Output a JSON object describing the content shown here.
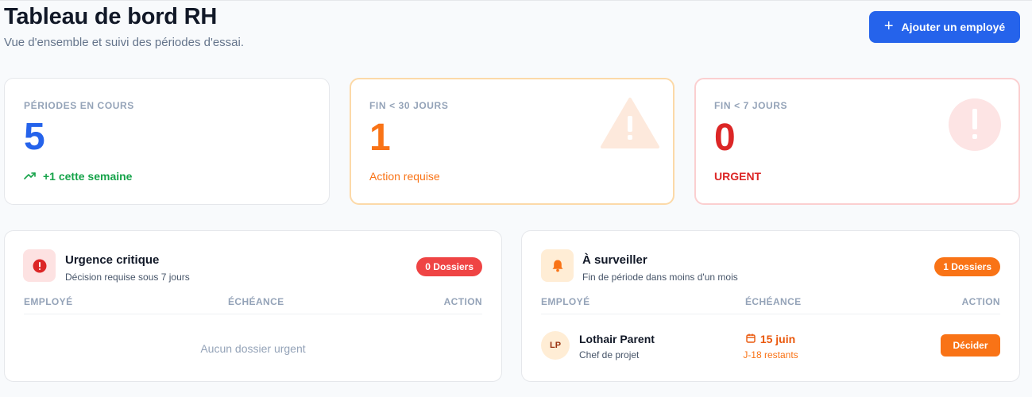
{
  "header": {
    "title": "Tableau de bord RH",
    "subtitle": "Vue d'ensemble et suivi des périodes d'essai.",
    "add_button": "Ajouter un employé"
  },
  "stats": {
    "in_progress": {
      "label": "PÉRIODES EN COURS",
      "value": "5",
      "trend": "+1 cette semaine",
      "icon": "trending-up-icon"
    },
    "ending_30": {
      "label": "FIN < 30 JOURS",
      "value": "1",
      "note": "Action requise",
      "icon": "warning-triangle-icon"
    },
    "ending_7": {
      "label": "FIN < 7 JOURS",
      "value": "0",
      "note": "URGENT",
      "icon": "alert-circle-icon"
    }
  },
  "critical": {
    "title": "Urgence critique",
    "subtitle": "Décision requise sous 7 jours",
    "badge": "0 Dossiers",
    "columns": [
      "EMPLOYÉ",
      "ÉCHÉANCE",
      "ACTION"
    ],
    "empty": "Aucun dossier urgent"
  },
  "watch": {
    "title": "À surveiller",
    "subtitle": "Fin de période dans moins d'un mois",
    "badge": "1 Dossiers",
    "columns": [
      "EMPLOYÉ",
      "ÉCHÉANCE",
      "ACTION"
    ],
    "rows": [
      {
        "initials": "LP",
        "name": "Lothair Parent",
        "role": "Chef de projet",
        "due": "15 juin",
        "remaining": "J-18 restants",
        "action": "Décider"
      }
    ]
  },
  "colors": {
    "accent": "#2563eb",
    "orange": "#f97316",
    "red": "#dc2626",
    "green": "#16a34a"
  }
}
